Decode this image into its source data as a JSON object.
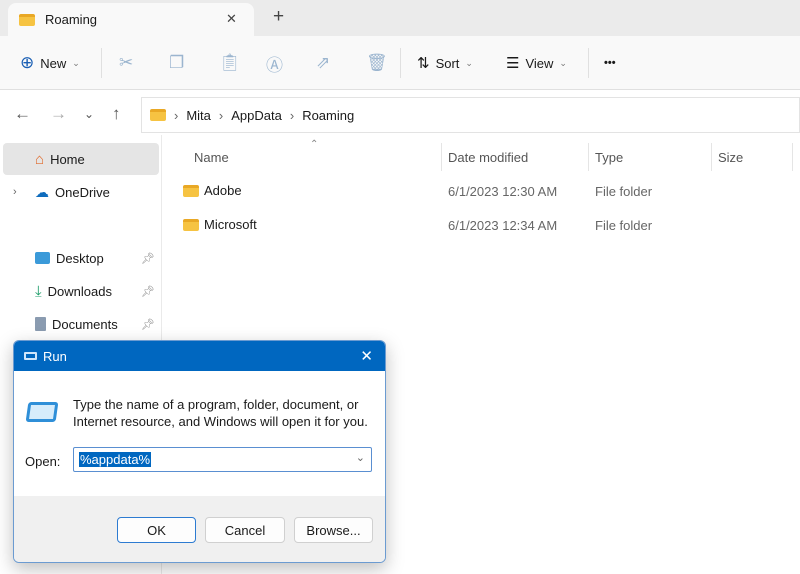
{
  "tab": {
    "title": "Roaming",
    "close": "✕",
    "new_tab": "+"
  },
  "toolbar": {
    "new_label": "New",
    "sort_label": "Sort",
    "view_label": "View",
    "more": "•••"
  },
  "address": {
    "crumbs": [
      "Mita",
      "AppData",
      "Roaming"
    ]
  },
  "sidebar": {
    "items": [
      {
        "label": "Home"
      },
      {
        "label": "OneDrive"
      },
      {
        "label": "Desktop"
      },
      {
        "label": "Downloads"
      },
      {
        "label": "Documents"
      }
    ]
  },
  "columns": {
    "name": "Name",
    "date": "Date modified",
    "type": "Type",
    "size": "Size"
  },
  "files": [
    {
      "name": "Adobe",
      "date": "6/1/2023 12:30 AM",
      "type": "File folder"
    },
    {
      "name": "Microsoft",
      "date": "6/1/2023 12:34 AM",
      "type": "File folder"
    }
  ],
  "run": {
    "title": "Run",
    "close": "✕",
    "message": "Type the name of a program, folder, document, or Internet resource, and Windows will open it for you.",
    "open_label": "Open:",
    "open_value": "%appdata%",
    "ok": "OK",
    "cancel": "Cancel",
    "browse": "Browse..."
  }
}
